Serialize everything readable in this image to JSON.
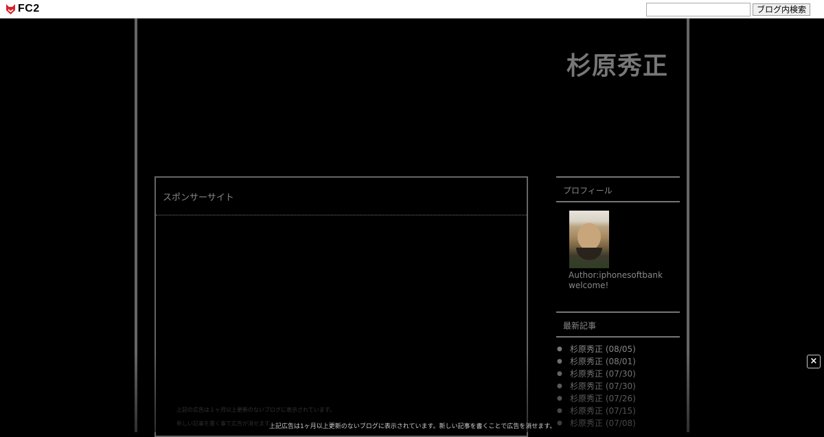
{
  "topbar": {
    "logo_text": "FC2",
    "search_placeholder": "",
    "search_button_label": "ブログ内検索"
  },
  "blog": {
    "title": "杉原秀正"
  },
  "sponsor": {
    "title": "スポンサーサイト",
    "note1": "上記の広告は１ヶ月以上更新のないブログに表示されています。",
    "note2": "新しい記事を書く事で広告が消せます。"
  },
  "sidebar": {
    "profile_heading": "プロフィール",
    "author": "Author:iphonesoftbank",
    "welcome": "welcome!",
    "recent_heading": "最新記事",
    "recent_items": [
      {
        "title": "杉原秀正",
        "date": "(08/05)"
      },
      {
        "title": "杉原秀正",
        "date": "(08/01)"
      },
      {
        "title": "杉原秀正",
        "date": "(07/30)"
      },
      {
        "title": "杉原秀正",
        "date": "(07/30)"
      },
      {
        "title": "杉原秀正",
        "date": "(07/26)"
      },
      {
        "title": "杉原秀正",
        "date": "(07/15)"
      },
      {
        "title": "杉原秀正",
        "date": "(07/08)"
      }
    ]
  },
  "overlay": {
    "note": "上記広告は1ヶ月以上更新のないブログに表示されています。新しい記事を書くことで広告を消せます。",
    "close_symbol": "×"
  },
  "icons": {
    "logo": "fc2-fox-icon",
    "close": "close-icon"
  }
}
